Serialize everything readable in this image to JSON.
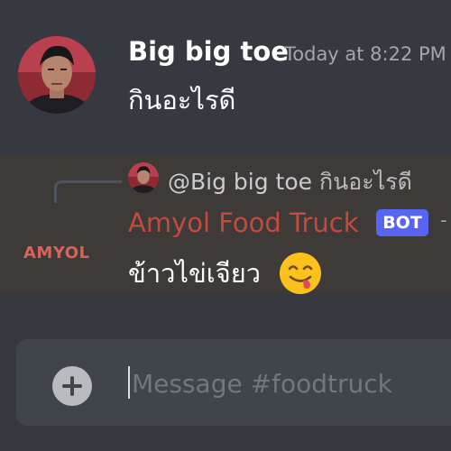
{
  "messages": [
    {
      "author": "Big big toe",
      "timestamp": "Today at 8:22 PM",
      "content": "กินอะไรดี"
    },
    {
      "reply": {
        "mention": "@Big big toe",
        "content": "กินอะไรดี"
      },
      "author": "Amyol Food Truck",
      "author_color": "#c34a3c",
      "badge": "BOT",
      "avatar_text": "AMYOL",
      "content": "ข้าวไข่เจียว",
      "emoji": "yum-face-icon"
    }
  ],
  "composer": {
    "placeholder": "Message #foodtruck"
  },
  "colors": {
    "background": "#36393f",
    "highlight": "#3d3a37",
    "accent": "#5865f2",
    "composer": "#40444b"
  }
}
